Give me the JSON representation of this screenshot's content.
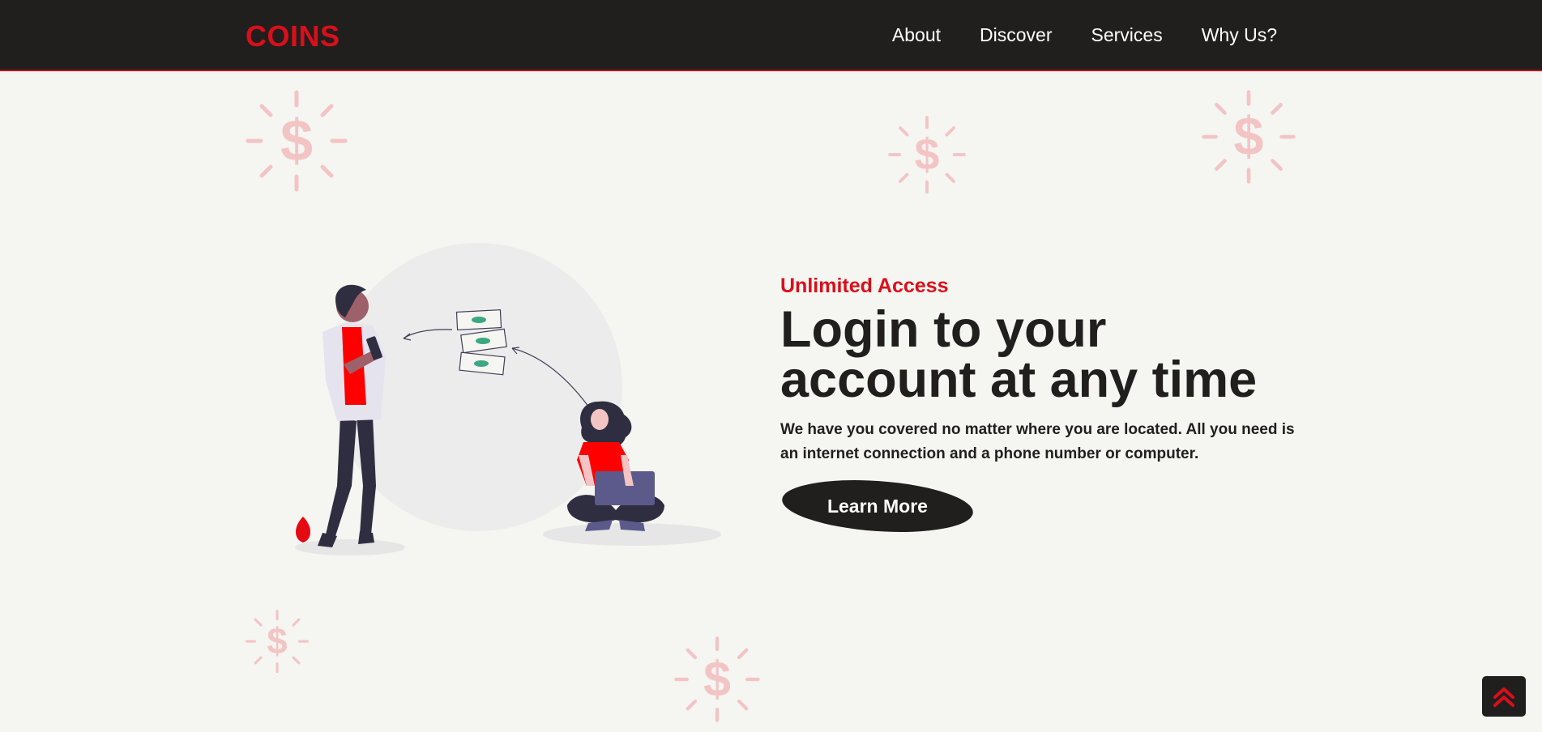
{
  "nav": {
    "logo": "COINS",
    "links": [
      "About",
      "Discover",
      "Services",
      "Why Us?"
    ]
  },
  "hero": {
    "eyebrow": "Unlimited Access",
    "headline": "Login to your account at any time",
    "lead": "We have you covered no matter where you are located. All you need is an internet connection and a phone number or computer.",
    "cta_label": "Learn More"
  },
  "icons": {
    "decor": "dollar-sun-icon",
    "scroll_top": "double-chevron-up-icon"
  },
  "colors": {
    "brand_red": "#d90f1a",
    "dark": "#201f1e",
    "background": "#f5f5f2",
    "decor_pink": "#f3c4c4"
  }
}
